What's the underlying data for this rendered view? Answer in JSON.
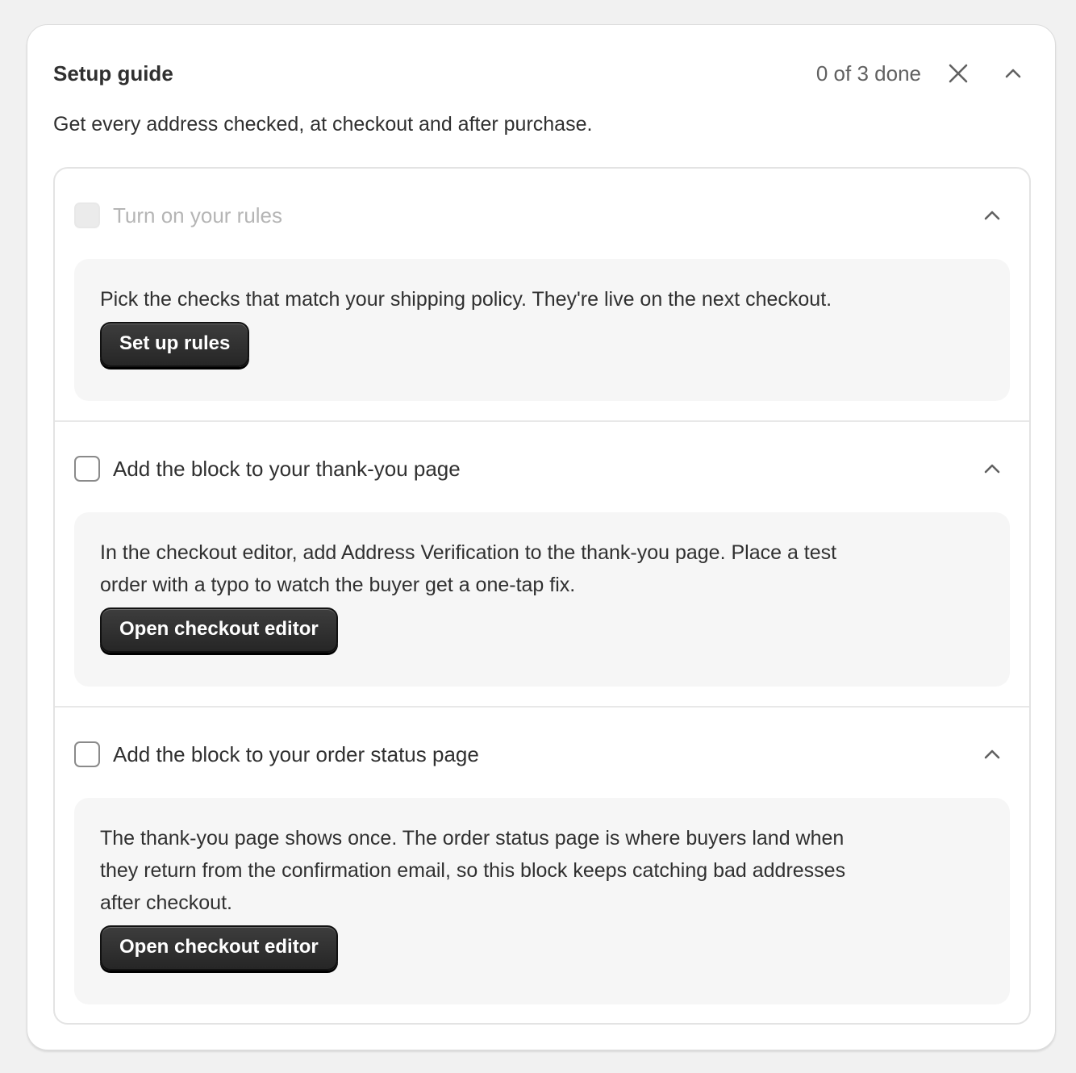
{
  "card": {
    "title": "Setup guide",
    "progress": "0 of 3 done",
    "subtitle": "Get every address checked, at checkout and after purchase.",
    "dismiss_icon": "close-icon",
    "collapse_icon": "chevron-up-icon"
  },
  "steps": [
    {
      "title": "Turn on your rules",
      "checked": false,
      "disabled": true,
      "expanded": true,
      "description": "Pick the checks that match your shipping policy. They're live on the next checkout.",
      "button_label": "Set up rules"
    },
    {
      "title": "Add the block to your thank-you page",
      "checked": false,
      "disabled": false,
      "expanded": true,
      "description": "In the checkout editor, add Address Verification to the thank-you page. Place a test\norder with a typo to watch the buyer get a one-tap fix.",
      "button_label": "Open checkout editor"
    },
    {
      "title": "Add the block to your order status page",
      "checked": false,
      "disabled": false,
      "expanded": true,
      "description": "The thank-you page shows once. The order status page is where buyers land when\nthey return from the confirmation email, so this block keeps catching bad addresses\nafter checkout.",
      "button_label": "Open checkout editor"
    }
  ],
  "colors": {
    "background": "#f1f1f1",
    "card": "#ffffff",
    "primary_button": "#303030",
    "text": "#303030",
    "muted_text": "#b5b5b5",
    "step_body": "#f6f6f6"
  }
}
